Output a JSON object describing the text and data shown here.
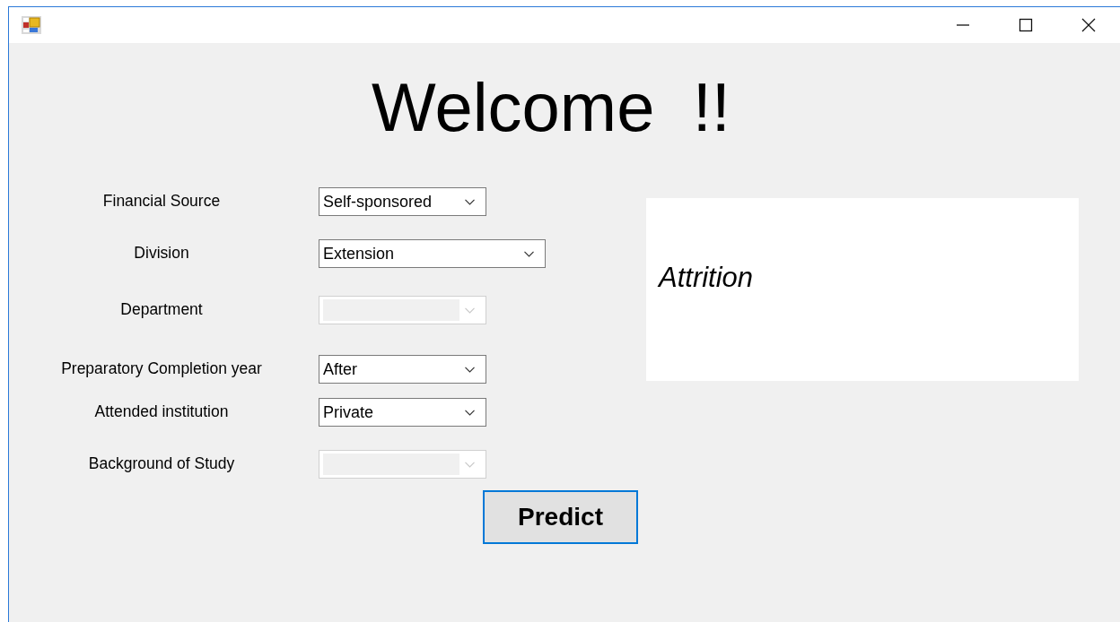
{
  "heading": "Welcome  !!",
  "fields": [
    {
      "label": "Financial Source",
      "value": "Self-sponsored",
      "disabled": false
    },
    {
      "label": "Division",
      "value": "Extension",
      "disabled": false
    },
    {
      "label": "Department",
      "disabled": true
    },
    {
      "label": "Preparatory Completion  year",
      "value": "After",
      "disabled": false
    },
    {
      "label": "Attended institution",
      "value": "Private",
      "disabled": false
    },
    {
      "label": "Background of Study",
      "disabled": true
    }
  ],
  "result": {
    "text": "Attrition"
  },
  "buttons": [
    {
      "label": "Predict",
      "focused": true
    }
  ]
}
